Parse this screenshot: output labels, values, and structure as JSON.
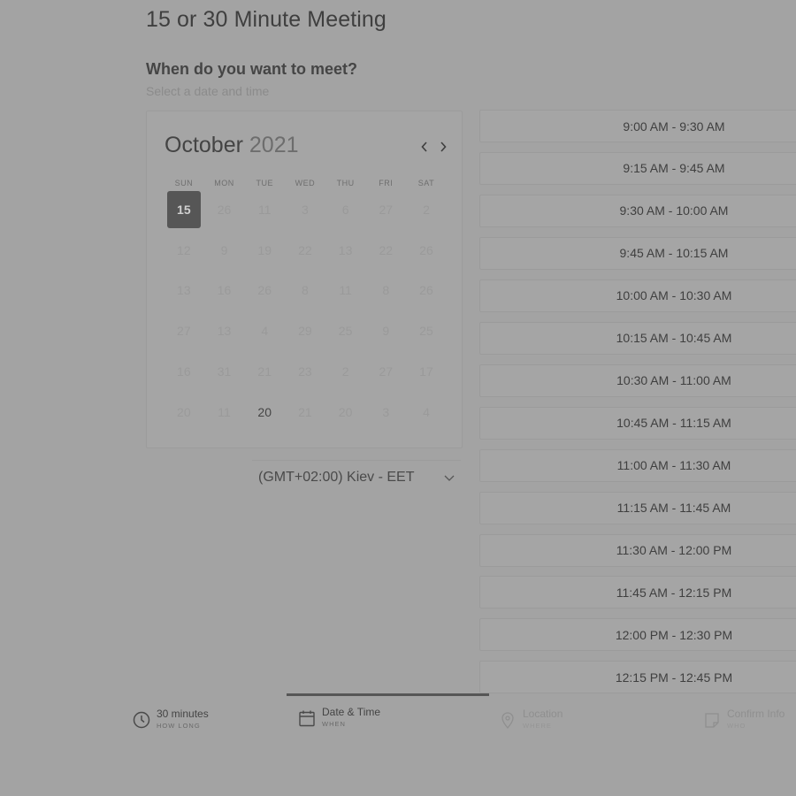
{
  "page": {
    "title": "15 or 30 Minute Meeting",
    "heading": "When do you want to meet?",
    "subheading": "Select a date and time"
  },
  "calendar": {
    "month": "October",
    "year": "2021",
    "prev_icon": "chevron-left-icon",
    "next_icon": "chevron-right-icon",
    "weekdays": [
      "SUN",
      "MON",
      "TUE",
      "WED",
      "THU",
      "FRI",
      "SAT"
    ],
    "weeks": [
      [
        "15",
        "26",
        "11",
        "3",
        "6",
        "27",
        "2"
      ],
      [
        "12",
        "9",
        "19",
        "22",
        "13",
        "22",
        "26"
      ],
      [
        "13",
        "16",
        "26",
        "8",
        "11",
        "8",
        "26"
      ],
      [
        "27",
        "13",
        "4",
        "29",
        "25",
        "9",
        "25"
      ],
      [
        "16",
        "31",
        "21",
        "23",
        "2",
        "27",
        "17"
      ],
      [
        "20",
        "11",
        "20",
        "21",
        "20",
        "3",
        "4"
      ]
    ],
    "selected_day": "15",
    "available_day": "20"
  },
  "timezone": {
    "label": "(GMT+02:00) Kiev - EET",
    "icon": "chevron-down-icon"
  },
  "slots": [
    "9:00 AM - 9:30 AM",
    "9:15 AM - 9:45 AM",
    "9:30 AM - 10:00 AM",
    "9:45 AM - 10:15 AM",
    "10:00 AM - 10:30 AM",
    "10:15 AM - 10:45 AM",
    "10:30 AM - 11:00 AM",
    "10:45 AM - 11:15 AM",
    "11:00 AM - 11:30 AM",
    "11:15 AM - 11:45 AM",
    "11:30 AM - 12:00 PM",
    "11:45 AM - 12:15 PM",
    "12:00 PM - 12:30 PM",
    "12:15 PM - 12:45 PM"
  ],
  "steps": [
    {
      "label": "30 minutes",
      "sub": "HOW LONG",
      "icon": "clock-icon",
      "state": "done"
    },
    {
      "label": "Date & Time",
      "sub": "WHEN",
      "icon": "calendar-icon",
      "state": "current"
    },
    {
      "label": "Location",
      "sub": "WHERE",
      "icon": "location-pin-icon",
      "state": "upcoming"
    },
    {
      "label": "Confirm Info",
      "sub": "WHO",
      "icon": "note-icon",
      "state": "upcoming"
    }
  ]
}
